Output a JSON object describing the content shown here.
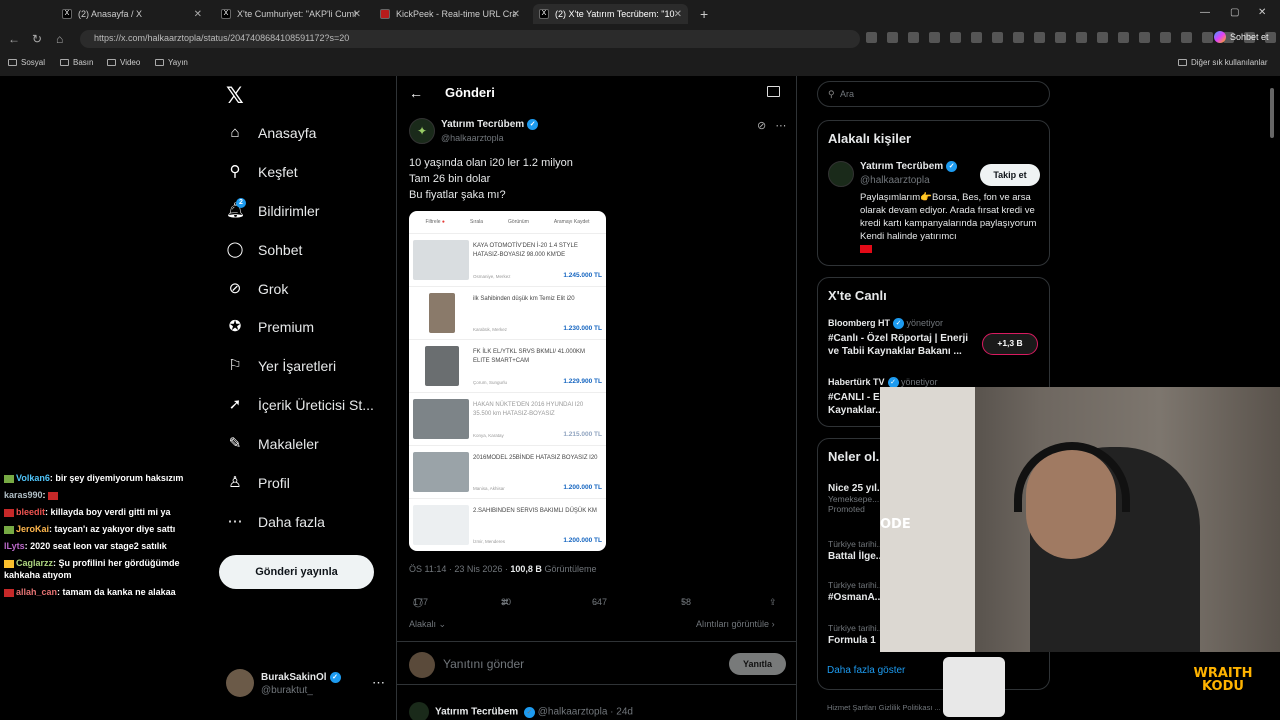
{
  "browser": {
    "tabs": [
      {
        "label": "(2) Anasayfa / X",
        "active": false
      },
      {
        "label": "X'te Cumhuriyet: \"AKP'li Cumhurb",
        "active": false
      },
      {
        "label": "KickPeek - Real-time URL Crawler",
        "active": false
      },
      {
        "label": "(2) X'te Yatırım Tecrübem: \"10 yaşı",
        "active": true
      }
    ],
    "url": "https://x.com/halkaarztopla/status/2047408684108591172?s=20",
    "chat_button": "Sohbet et",
    "bookmarks": [
      "Sosyal",
      "Basın",
      "Video",
      "Yayın"
    ],
    "other_bookmarks": "Diğer sık kullanılanlar"
  },
  "nav": {
    "items": [
      "Anasayfa",
      "Keşfet",
      "Bildirimler",
      "Sohbet",
      "Grok",
      "Premium",
      "Yer İşaretleri",
      "İçerik Üreticisi St...",
      "Makaleler",
      "Profil",
      "Daha fazla"
    ],
    "icons": [
      "home-icon",
      "search-icon",
      "bell-icon",
      "chat-icon",
      "grok-icon",
      "premium-icon",
      "bookmark-icon",
      "rocket-icon",
      "article-icon",
      "profile-icon",
      "more-icon"
    ],
    "notification_count": "2",
    "post_button": "Gönderi yayınla",
    "account": {
      "name": "BurakSakinOl",
      "handle": "@buraktut_"
    }
  },
  "chat": [
    {
      "user": "Volkan6",
      "text": "bir şey diyemiyorum haksızım",
      "color": "#4fc3f7"
    },
    {
      "user": "karas990",
      "text": "",
      "color": "#b0bec5"
    },
    {
      "user": "bleedit",
      "text": "killayda boy verdi gitti mi ya",
      "color": "#ef5350"
    },
    {
      "user": "JeroKai",
      "text": "taycan'ı az yakıyor diye sattı",
      "color": "#ffb74d"
    },
    {
      "user": "lLyts",
      "text": "2020 seat leon var stage2 satılık",
      "color": "#ba68c8"
    },
    {
      "user": "Caglarzz",
      "text": "Şu profilini her gördüğümde kahkaha atıyom",
      "color": "#aed581"
    },
    {
      "user": "allah_can",
      "text": "tamam da kanka ne alakaa",
      "color": "#e57373"
    }
  ],
  "main": {
    "header": "Gönderi",
    "author": {
      "name": "Yatırım Tecrübem",
      "handle": "@halkaarztopla"
    },
    "text": "10 yaşında olan i20 ler 1.2 milyon\nTam 26 bin dolar\nBu fiyatlar şaka mı?",
    "screenshot": {
      "filters": [
        "Filtrele",
        "Sırala",
        "Görünüm",
        "Aramayı Kaydet"
      ],
      "listings": [
        {
          "title": "KAYA OTOMOTİV'DEN İ-20 1.4 STYLE HATASIZ-BOYASIZ 98.000 KM'DE",
          "location": "Osmaniye, Merkez",
          "price": "1.245.000 TL"
        },
        {
          "title": "ilk Sahibinden düşük km Temiz Elit i20",
          "location": "Karabük, Merkez",
          "price": "1.230.000 TL"
        },
        {
          "title": "FK İLK EL/YTKL SRVS BKMLI/ 41.000KM ELITE SMART+CAM",
          "location": "Çorum, Sungurlu",
          "price": "1.229.900 TL"
        },
        {
          "title": "HAKAN NÜKTE'DEN 2016 HYUNDAI I20 35.500 km HATASIZ-BOYASIZ",
          "location": "Konya, Karatay",
          "price": "1.215.000 TL"
        },
        {
          "title": "2016MODEL 25BİNDE HATASIZ BOYASIZ I20",
          "location": "Manisa, Akhisar",
          "price": "1.200.000 TL"
        },
        {
          "title": "2.SAHIBINDEN SERVIS BAKIMLI DÜŞÜK KM",
          "location": "İzmir, Menderes",
          "price": "1.200.000 TL"
        }
      ]
    },
    "time": "ÖS 11:14 · 23 Nis 2026 ·",
    "views": "100,8 B",
    "views_label": "Görüntüleme",
    "actions": {
      "replies": "177",
      "reposts": "30",
      "likes": "647",
      "bookmarks": "58"
    },
    "relevant": "Alakalı",
    "quotes": "Alıntıları görüntüle",
    "reply_placeholder": "Yanıtını gönder",
    "reply_button": "Yanıtla",
    "next_post": {
      "name": "Yatırım Tecrübem",
      "handle": "@halkaarztopla · 24d"
    }
  },
  "sidebar": {
    "search_placeholder": "Ara",
    "related_title": "Alakalı kişiler",
    "related": {
      "name": "Yatırım Tecrübem",
      "handle": "@halkaarztopla",
      "follow": "Takip et",
      "bio": "Paylaşımlarım👉Borsa, Bes, fon ve arsa olarak devam ediyor. Arada fırsat kredi ve kredi kartı kampanyalarında paylaşıyorum Kendi halinde yatırımcı"
    },
    "live_title": "X'te Canlı",
    "live": [
      {
        "account": "Bloomberg HT",
        "manager": "yönetiyor",
        "title": "#Canlı - Özel Röportaj | Enerji ve Tabii Kaynaklar Bakanı ..."
      },
      {
        "account": "Habertürk TV",
        "manager": "yönetiyor",
        "title": "#CANLI - E... Kaynaklar..."
      }
    ],
    "live_count": "+1,3 B",
    "whats_title": "Neler ol...",
    "trends": [
      {
        "context": "Nice 25 yıl...",
        "title": "Yemeksepe...",
        "sub": "Promoted"
      },
      {
        "context": "Türkiye tarihi...",
        "title": "Battal İlge..."
      },
      {
        "context": "Türkiye tarihi...",
        "title": "#OsmanA..."
      },
      {
        "context": "Türkiye tarihi...",
        "title": "Formula 1"
      }
    ],
    "more": "Daha fazla göster",
    "footer": "Hizmet Şartları   Gizlilik Politikası ..."
  },
  "overlay": {
    "brand": "WRAITH KODU",
    "cam_text": "ODE"
  }
}
